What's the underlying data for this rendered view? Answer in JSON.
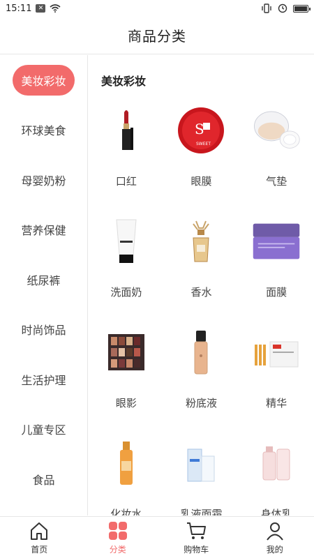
{
  "status_bar": {
    "time": "15:11",
    "notif_icon": "x-box-icon"
  },
  "header": {
    "title": "商品分类"
  },
  "sidebar": {
    "items": [
      {
        "label": "美妆彩妆",
        "active": true
      },
      {
        "label": "环球美食"
      },
      {
        "label": "母婴奶粉"
      },
      {
        "label": "营养保健"
      },
      {
        "label": "纸尿裤"
      },
      {
        "label": "时尚饰品"
      },
      {
        "label": "生活护理"
      },
      {
        "label": "儿童专区"
      },
      {
        "label": "食品"
      }
    ]
  },
  "main": {
    "section_title": "美妆彩妆",
    "products": [
      {
        "label": "口红",
        "icon": "lipstick-image"
      },
      {
        "label": "眼膜",
        "icon": "eye-mask-image"
      },
      {
        "label": "气垫",
        "icon": "cushion-compact-image"
      },
      {
        "label": "洗面奶",
        "icon": "cleanser-tube-image"
      },
      {
        "label": "香水",
        "icon": "perfume-bottle-image"
      },
      {
        "label": "面膜",
        "icon": "face-mask-jar-image"
      },
      {
        "label": "眼影",
        "icon": "eyeshadow-palette-image"
      },
      {
        "label": "粉底液",
        "icon": "foundation-bottle-image"
      },
      {
        "label": "精华",
        "icon": "serum-ampoules-image"
      },
      {
        "label": "化妆水",
        "icon": "toner-bottle-image"
      },
      {
        "label": "乳液面霜",
        "icon": "lotion-image"
      },
      {
        "label": "身体乳",
        "icon": "body-lotion-image"
      }
    ]
  },
  "bottom_nav": {
    "items": [
      {
        "label": "首页",
        "icon": "home-icon"
      },
      {
        "label": "分类",
        "icon": "category-icon",
        "active": true
      },
      {
        "label": "购物车",
        "icon": "cart-icon"
      },
      {
        "label": "我的",
        "icon": "profile-icon"
      }
    ]
  },
  "colors": {
    "accent": "#f26b6b",
    "divider": "#e6e6e6"
  }
}
